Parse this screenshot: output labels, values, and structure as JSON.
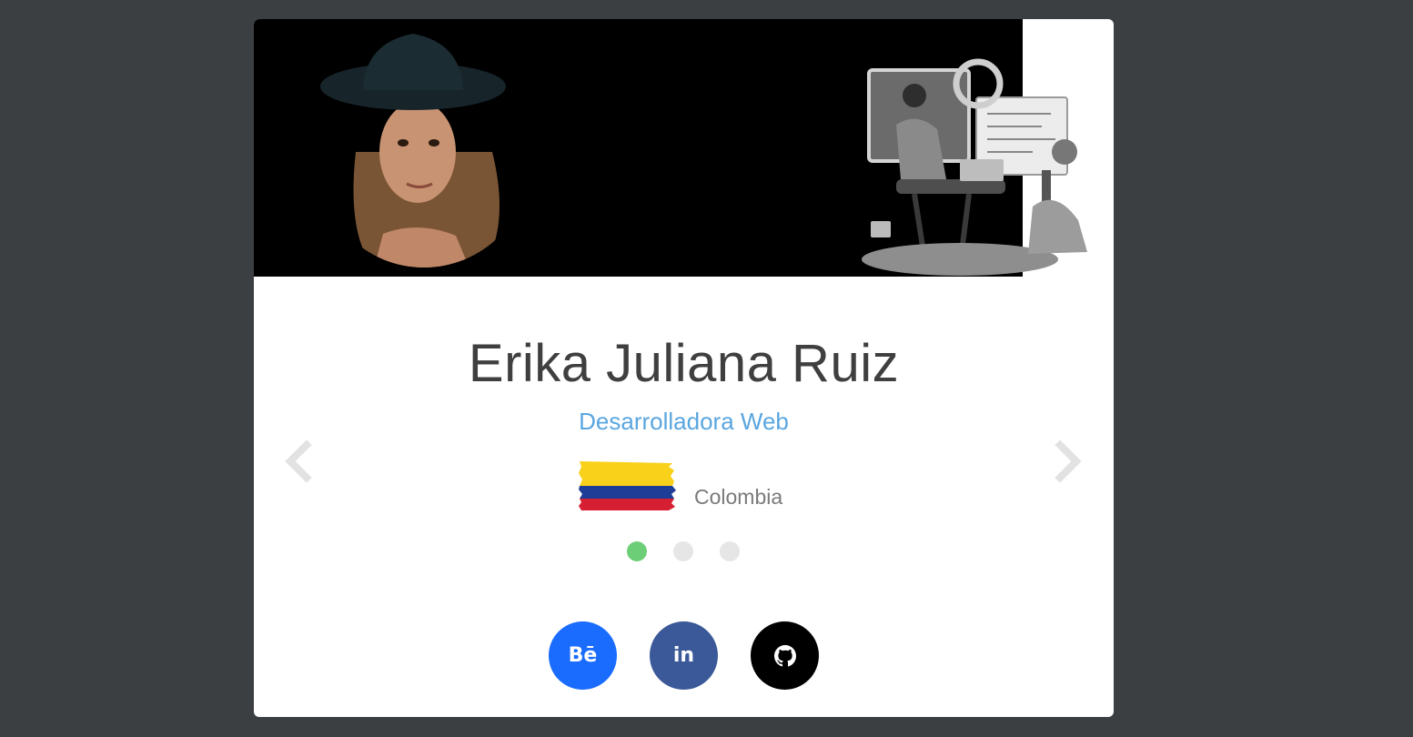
{
  "profile": {
    "name": "Erika Juliana Ruiz",
    "role": "Desarrolladora Web",
    "country": "Colombia"
  },
  "carousel": {
    "total_slides": 3,
    "active_slide": 1
  },
  "socials": {
    "behance_label": "Bē",
    "linkedin_label": "in"
  },
  "colors": {
    "page_background": "#3c3f42",
    "card_background": "#ffffff",
    "role_text": "#5aa6e0",
    "active_dot": "#6dce78",
    "inactive_dot": "#e6e6e6",
    "behance": "#1a6cff",
    "linkedin": "#3b5998",
    "github": "#000000"
  },
  "icons": {
    "prev": "chevron-left-icon",
    "next": "chevron-right-icon",
    "github": "github-icon"
  }
}
